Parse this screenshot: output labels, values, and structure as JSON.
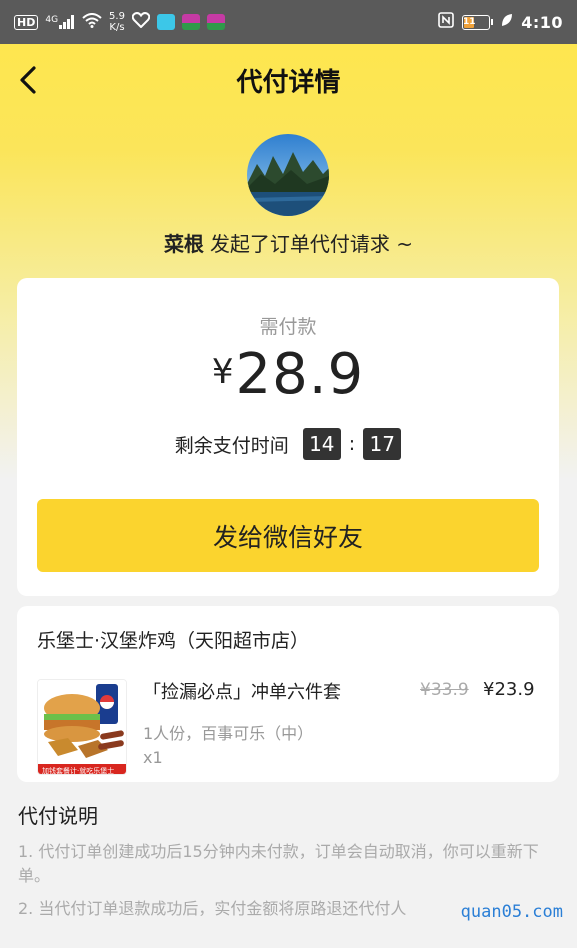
{
  "status_bar": {
    "hd": "HD",
    "network": "4G",
    "speed_value": "5.9",
    "speed_unit": "K/s",
    "battery_level": "11",
    "time": "4:10"
  },
  "nav": {
    "title": "代付详情"
  },
  "requester": {
    "name": "菜根",
    "message": "发起了订单代付请求 ~"
  },
  "payment": {
    "label": "需付款",
    "currency": "¥",
    "amount": "28.9",
    "remaining_label": "剩余支付时间",
    "minutes": "14",
    "colon": ":",
    "seconds": "17",
    "send_button": "发给微信好友"
  },
  "order": {
    "store": "乐堡士·汉堡炸鸡（天阳超市店）",
    "item": {
      "name": "「捡漏必点」冲单六件套",
      "original_price": "¥33.9",
      "price": "¥23.9",
      "spec": "1人份，百事可乐（中）",
      "quantity": "x1",
      "image_caption": "加钱套餐计·就吃乐堡士"
    }
  },
  "notes": {
    "title": "代付说明",
    "items": [
      "1. 代付订单创建成功后15分钟内未付款，订单会自动取消，你可以重新下单。",
      "2. 当代付订单退款成功后，实付金额将原路退还代付人"
    ]
  },
  "watermark": "quan05.com",
  "colors": {
    "accent": "#fbd42e",
    "status_bar": "#5a5a5a",
    "timer_box": "#333333"
  }
}
